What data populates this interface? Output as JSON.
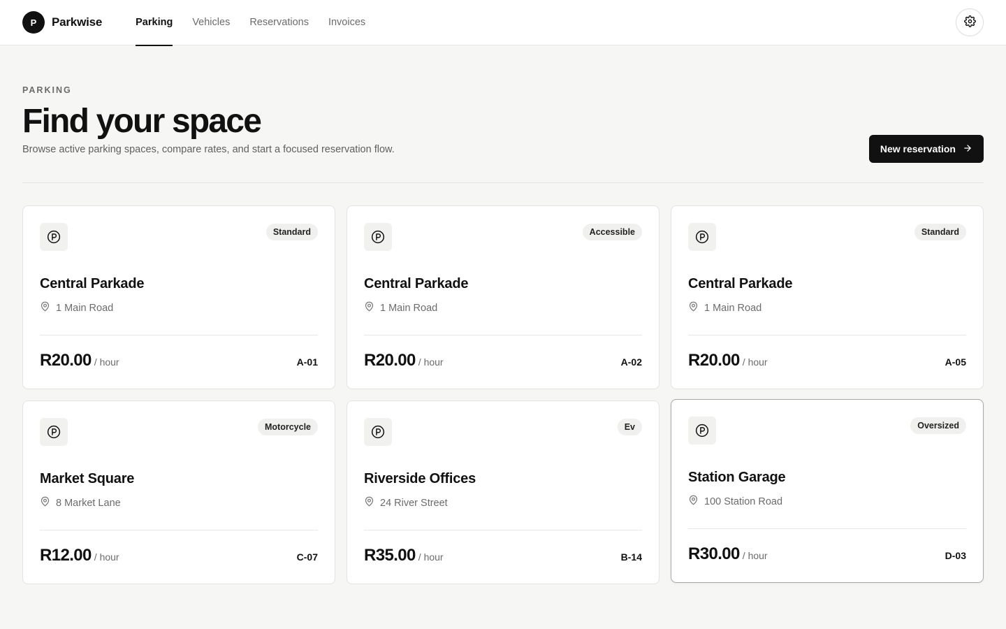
{
  "brand": {
    "logo_letter": "P",
    "name": "Parkwise"
  },
  "nav": [
    {
      "label": "Parking",
      "active": true
    },
    {
      "label": "Vehicles",
      "active": false
    },
    {
      "label": "Reservations",
      "active": false
    },
    {
      "label": "Invoices",
      "active": false
    }
  ],
  "header": {
    "settings_icon": "gear-icon"
  },
  "page": {
    "eyebrow": "PARKING",
    "title": "Find your space",
    "subtitle": "Browse active parking spaces, compare rates, and start a focused reservation flow.",
    "new_button_label": "New reservation"
  },
  "cards": [
    {
      "badge": "Standard",
      "name": "Central Parkade",
      "address": "1 Main Road",
      "price": "R20.00",
      "unit": "/ hour",
      "code": "A-01"
    },
    {
      "badge": "Accessible",
      "name": "Central Parkade",
      "address": "1 Main Road",
      "price": "R20.00",
      "unit": "/ hour",
      "code": "A-02"
    },
    {
      "badge": "Standard",
      "name": "Central Parkade",
      "address": "1 Main Road",
      "price": "R20.00",
      "unit": "/ hour",
      "code": "A-05"
    },
    {
      "badge": "Motorcycle",
      "name": "Market Square",
      "address": "8 Market Lane",
      "price": "R12.00",
      "unit": "/ hour",
      "code": "C-07"
    },
    {
      "badge": "Ev",
      "name": "Riverside Offices",
      "address": "24 River Street",
      "price": "R35.00",
      "unit": "/ hour",
      "code": "B-14"
    },
    {
      "badge": "Oversized",
      "name": "Station Garage",
      "address": "100 Station Road",
      "price": "R30.00",
      "unit": "/ hour",
      "code": "D-03"
    }
  ],
  "colors": {
    "accent": "#111111",
    "background": "#f6f6f5",
    "muted_text": "#6b6b6b"
  }
}
